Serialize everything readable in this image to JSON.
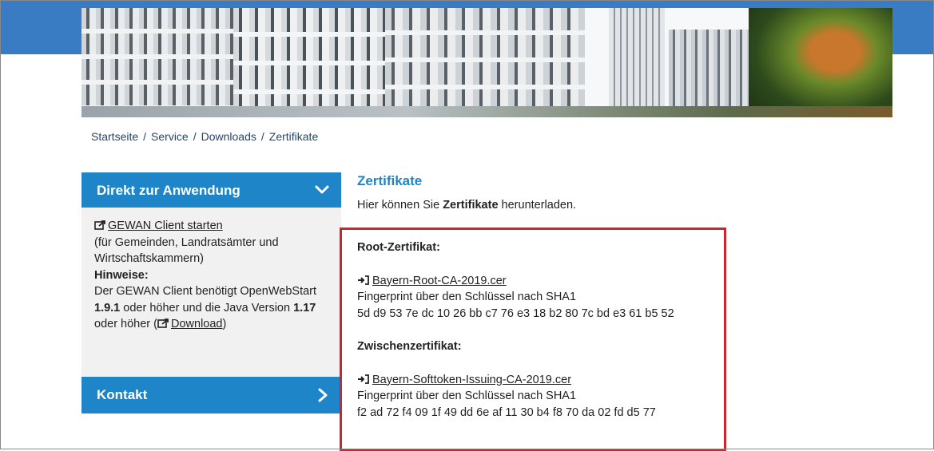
{
  "breadcrumb": {
    "items": [
      "Startseite",
      "Service",
      "Downloads",
      "Zertifikate"
    ],
    "separator": "/"
  },
  "sidebar": {
    "section_title": "Direkt zur Anwendung",
    "client_link": "GEWAN Client starten",
    "client_note": "(für Gemeinden, Landratsämter und Wirtschaftskammern)",
    "hints_label": "Hinweise:",
    "hint_text_1": "Der GEWAN Client benötigt OpenWebStart",
    "hint_version_ows": "1.9.1",
    "hint_text_2": "oder höher und die Java Version",
    "hint_version_java": "1.17",
    "hint_text_3": "oder höher (",
    "download_link": "Download",
    "hint_text_4": ")",
    "kontakt_title": "Kontakt"
  },
  "content": {
    "title": "Zertifikate",
    "intro_pre": "Hier können Sie",
    "intro_bold": "Zertifikate",
    "intro_post": "herunterladen.",
    "root": {
      "heading": "Root-Zertifikat:",
      "file": "Bayern-Root-CA-2019.cer",
      "fingerprint_label": "Fingerprint über den Schlüssel nach SHA1",
      "fingerprint": "5d d9 53 7e dc 10 26 bb c7 76 e3 18 b2 80 7c bd e3 61 b5 52"
    },
    "intermediate": {
      "heading": "Zwischenzertifikat:",
      "file": "Bayern-Softtoken-Issuing-CA-2019.cer",
      "fingerprint_label": "Fingerprint über den Schlüssel nach SHA1",
      "fingerprint": "f2 ad 72 f4 09 1f 49 dd 6e af 11 30 b4 f8 70 da 02 fd d5 77"
    }
  },
  "colors": {
    "brand_blue": "#1e86c8",
    "header_blue": "#3a7cc3",
    "highlight_red": "#d2232a",
    "breadcrumb_text": "#24466b"
  },
  "icons": {
    "external_link": "external-link-icon",
    "download": "sign-in-download-icon",
    "chevron_down": "chevron-down-icon",
    "chevron_right": "chevron-right-icon"
  }
}
